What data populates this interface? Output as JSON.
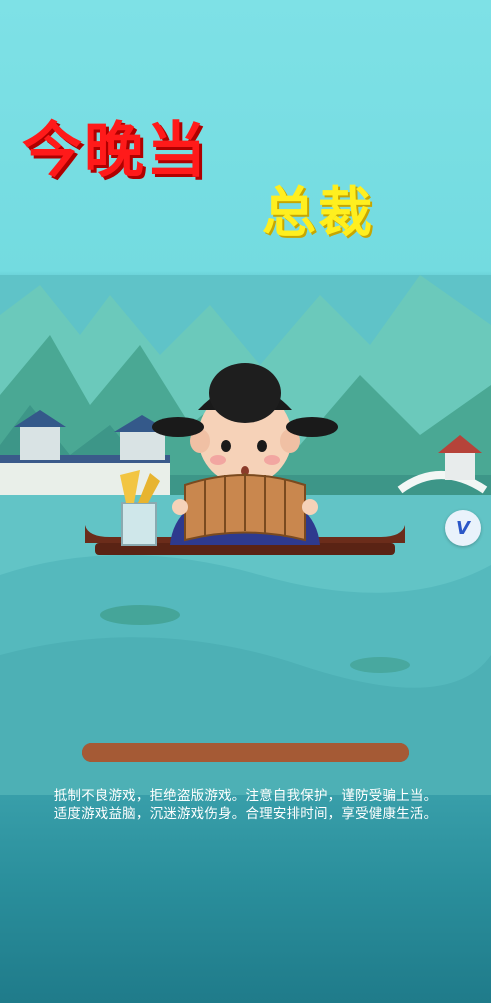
{
  "title": {
    "line1": "今晚当",
    "line2": "总裁"
  },
  "loading": {
    "progress": 1.0
  },
  "notice": {
    "line1": "抵制不良游戏，拒绝盗版游戏。注意自我保护，谨防受骗上当。",
    "line2": "适度游戏益脑，沉迷游戏伤身。合理安排时间，享受健康生活。"
  },
  "badge": {
    "label": "V",
    "icon": "v-logo-icon"
  },
  "colors": {
    "title_red": "#ff1a1a",
    "title_yellow": "#ffef1f",
    "progress": "#7a3f2a"
  }
}
